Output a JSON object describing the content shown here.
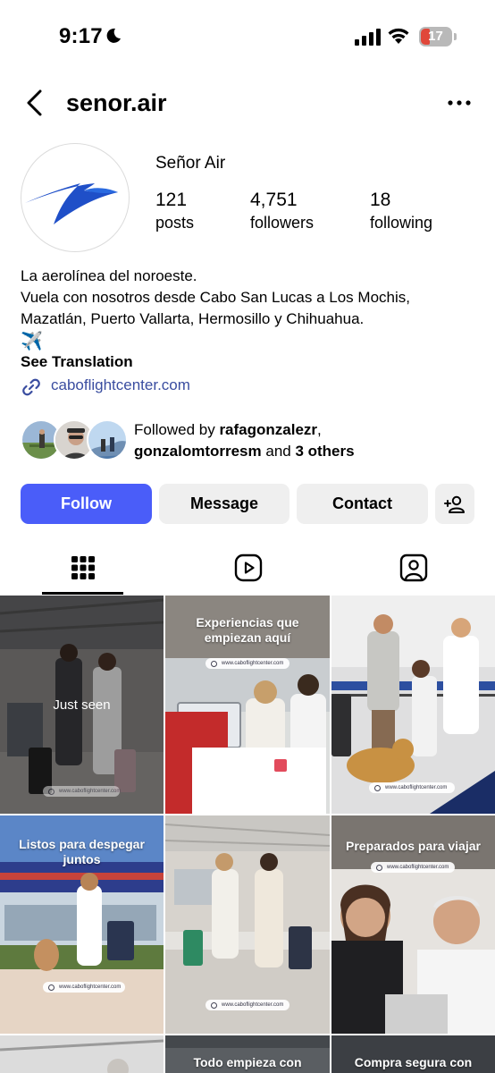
{
  "status_bar": {
    "time": "9:17",
    "battery": "17"
  },
  "header": {
    "username": "senor.air"
  },
  "profile": {
    "display_name": "Señor Air",
    "stats": [
      {
        "value": "121",
        "label": "posts"
      },
      {
        "value": "4,751",
        "label": "followers"
      },
      {
        "value": "18",
        "label": "following"
      }
    ],
    "bio": [
      "La aerolínea del noroeste.",
      "Vuela con nosotros desde Cabo San Lucas a Los Mochis,",
      "Mazatlán, Puerto Vallarta, Hermosillo y Chihuahua."
    ],
    "bio_emoji": "✈️",
    "see_translation": "See Translation",
    "link": "caboflightcenter.com",
    "followed_by": {
      "prefix": "Followed by ",
      "user1": "rafagonzalezr",
      "sep": ",",
      "user2": "gonzalomtorresm",
      "and": " and ",
      "others": "3 others"
    }
  },
  "actions": {
    "follow": "Follow",
    "message": "Message",
    "contact": "Contact"
  },
  "tabs": [
    "grid-icon",
    "reels-icon",
    "tagged-icon"
  ],
  "grid": {
    "posts": [
      {
        "overlay": "Just seen",
        "url": "www.caboflightcenter.com"
      },
      {
        "title": "Experiencias que empiezan aquí",
        "url": "www.caboflightcenter.com"
      },
      {
        "url": "www.caboflightcenter.com"
      },
      {
        "title": "Listos para despegar juntos",
        "url": "www.caboflightcenter.com"
      },
      {
        "url": "www.caboflightcenter.com"
      },
      {
        "title": "Preparados para viajar",
        "url": "www.caboflightcenter.com"
      },
      {
        "title": ""
      },
      {
        "title": "Todo empieza con"
      },
      {
        "title": "Compra segura con"
      }
    ]
  },
  "colors": {
    "follow_button": "#4a5df9",
    "secondary_button": "#efefef",
    "link": "#3a4da0",
    "logo_blue": "#1f4fc8"
  }
}
